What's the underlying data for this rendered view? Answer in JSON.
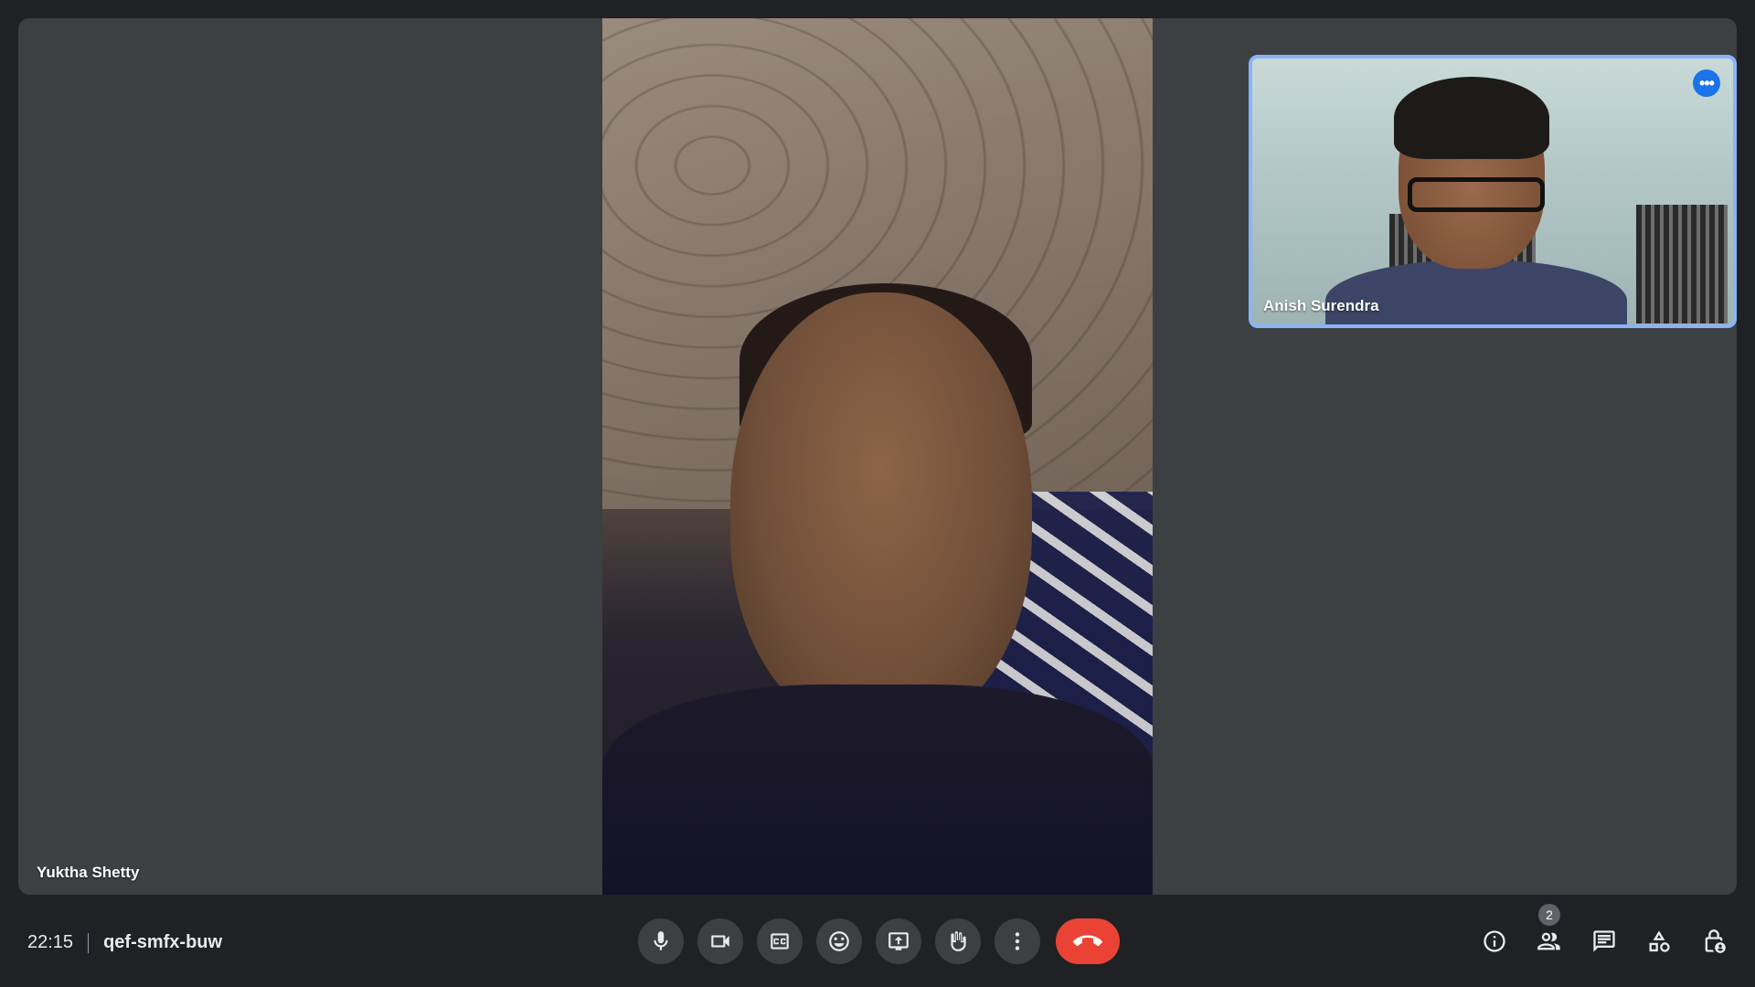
{
  "participants": {
    "main": {
      "name": "Yuktha Shetty"
    },
    "self": {
      "name": "Anish Surendra",
      "more_label": "•••"
    }
  },
  "meeting": {
    "time": "22:15",
    "code": "qef-smfx-buw"
  },
  "controls": [
    {
      "name": "microphone-button",
      "icon": "mic-icon"
    },
    {
      "name": "camera-button",
      "icon": "videocam-icon"
    },
    {
      "name": "captions-button",
      "icon": "closed-captions-icon"
    },
    {
      "name": "reactions-button",
      "icon": "emoji-icon"
    },
    {
      "name": "present-button",
      "icon": "present-screen-icon"
    },
    {
      "name": "raise-hand-button",
      "icon": "hand-icon"
    },
    {
      "name": "more-options-button",
      "icon": "more-vert-icon"
    },
    {
      "name": "leave-call-button",
      "icon": "call-end-icon",
      "color": "#ea4335"
    }
  ],
  "right_controls": {
    "people_count": "2",
    "items": [
      {
        "name": "meeting-details-button",
        "icon": "info-icon"
      },
      {
        "name": "people-button",
        "icon": "people-icon"
      },
      {
        "name": "chat-button",
        "icon": "chat-icon"
      },
      {
        "name": "activities-button",
        "icon": "activities-icon"
      },
      {
        "name": "host-controls-button",
        "icon": "lock-person-icon"
      }
    ]
  },
  "colors": {
    "background": "#202124",
    "tile": "#3c4043",
    "active_border": "#8ab4f8",
    "accent": "#1a73e8",
    "end_call": "#ea4335"
  }
}
